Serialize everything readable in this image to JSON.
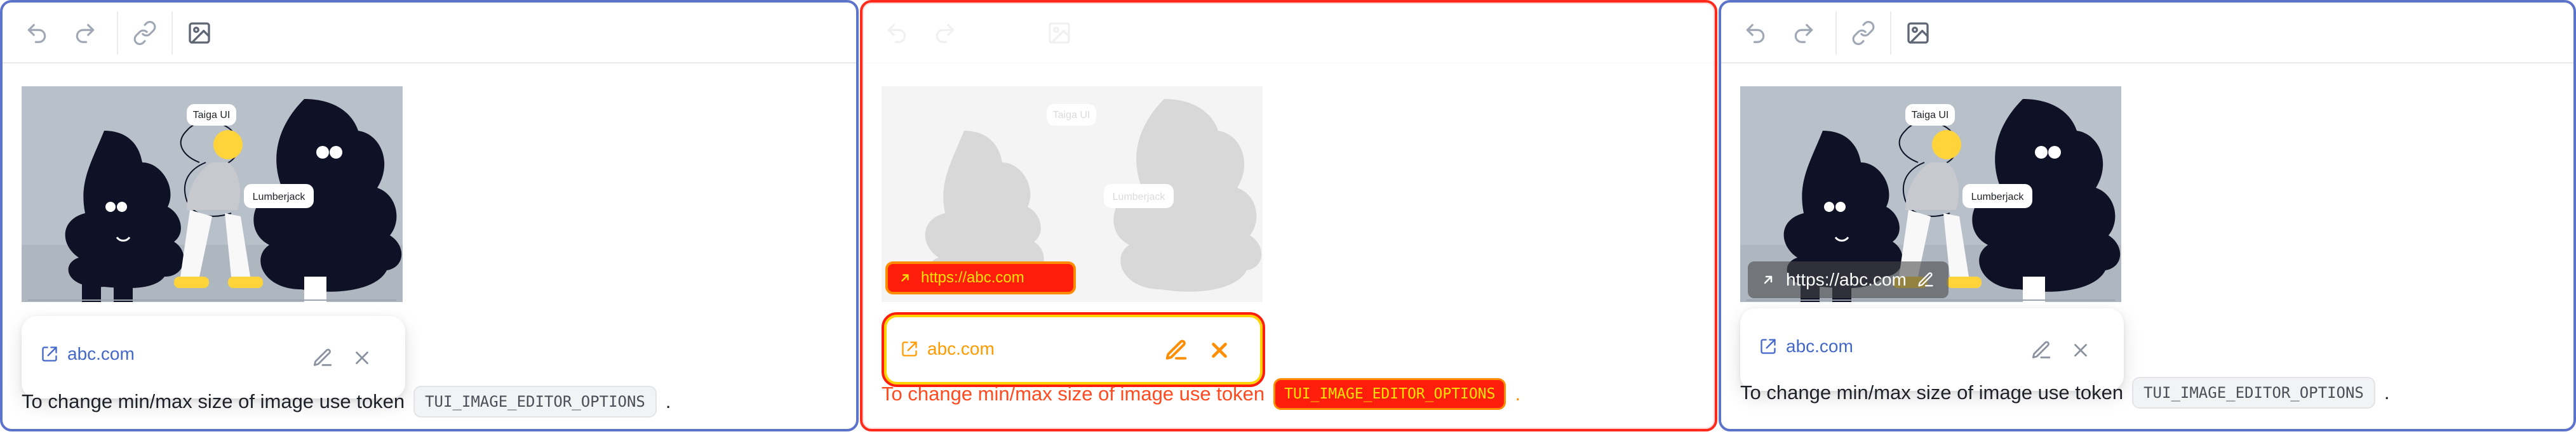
{
  "image": {
    "label_taiga": "Taiga UI",
    "label_lumberjack": "Lumberjack"
  },
  "panels": {
    "left": {
      "link_text": "abc.com",
      "text_before_token": "To change min/max size of image use token",
      "token": "TUI_IMAGE_EDITOR_OPTIONS",
      "punctuation": "."
    },
    "middle": {
      "chip_url": "https://abc.com",
      "link_text": "abc.com",
      "text_before_token": "To change min/max size of image use token",
      "token": "TUI_IMAGE_EDITOR_OPTIONS",
      "punctuation": "."
    },
    "right": {
      "chip_url": "https://abc.com",
      "link_text": "abc.com",
      "text_before_token": "To change min/max size of image use token",
      "token": "TUI_IMAGE_EDITOR_OPTIONS",
      "punctuation": "."
    }
  },
  "icons": {
    "undo": "undo-icon",
    "redo": "redo-icon",
    "link": "link-icon",
    "image": "image-icon",
    "external_link": "external-link-icon",
    "arrow_up_right": "arrow-up-right-icon",
    "pencil": "pencil-icon",
    "close": "close-icon"
  },
  "colors": {
    "focus_border": "#5b73c9",
    "diff_red": "#ff1d0c",
    "diff_orange": "#ff8b00",
    "link": "#4368c9"
  }
}
